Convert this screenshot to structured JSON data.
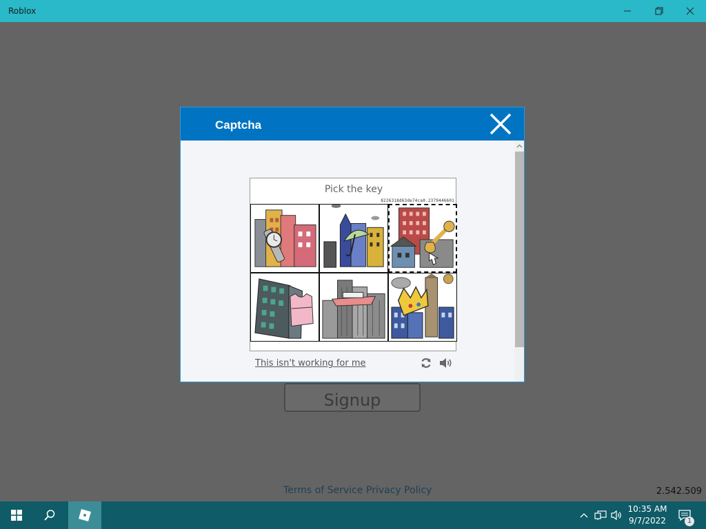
{
  "window": {
    "title": "Roblox"
  },
  "page": {
    "signup_label": "Signup",
    "terms_label": "Terms of Service",
    "privacy_label": "Privacy Policy",
    "version": "2.542.509"
  },
  "captcha": {
    "title": "Captcha",
    "prompt": "Pick the key",
    "challenge_id": "8226318d63de74ca0.2379446601",
    "not_working_label": "This isn't working for me",
    "tiles": [
      {
        "icon": "wristwatch-city-tile",
        "selected": false
      },
      {
        "icon": "umbrella-city-tile",
        "selected": false
      },
      {
        "icon": "key-city-tile",
        "selected": true
      },
      {
        "icon": "tanktop-city-tile",
        "selected": false
      },
      {
        "icon": "boat-city-tile",
        "selected": false
      },
      {
        "icon": "crown-city-tile",
        "selected": false
      }
    ]
  },
  "taskbar": {
    "time": "10:35 AM",
    "date": "9/7/2022",
    "notification_count": "1"
  },
  "colors": {
    "titlebar": "#2ab9c9",
    "modal_header": "#0074c2",
    "taskbar": "#0f5b67",
    "background": "#646464"
  }
}
